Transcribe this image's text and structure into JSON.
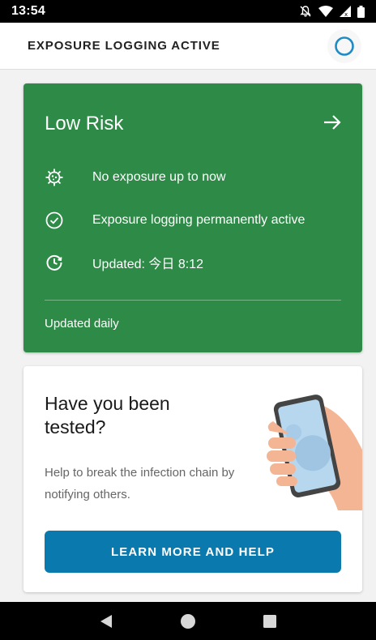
{
  "status_bar": {
    "time": "13:54"
  },
  "app_bar": {
    "title": "EXPOSURE LOGGING ACTIVE"
  },
  "risk_card": {
    "title": "Low Risk",
    "rows": [
      {
        "icon": "virus-icon",
        "text": "No exposure up to now"
      },
      {
        "icon": "check-circle-icon",
        "text": "Exposure logging permanently active"
      },
      {
        "icon": "clock-refresh-icon",
        "text": "Updated: 今日 8:12"
      }
    ],
    "footer": "Updated daily",
    "color": "#2e8a47"
  },
  "test_card": {
    "title": "Have you been tested?",
    "body": "Help to break the infection chain by notifying others.",
    "button_label": "LEARN MORE AND HELP",
    "button_color": "#0a79ad"
  }
}
